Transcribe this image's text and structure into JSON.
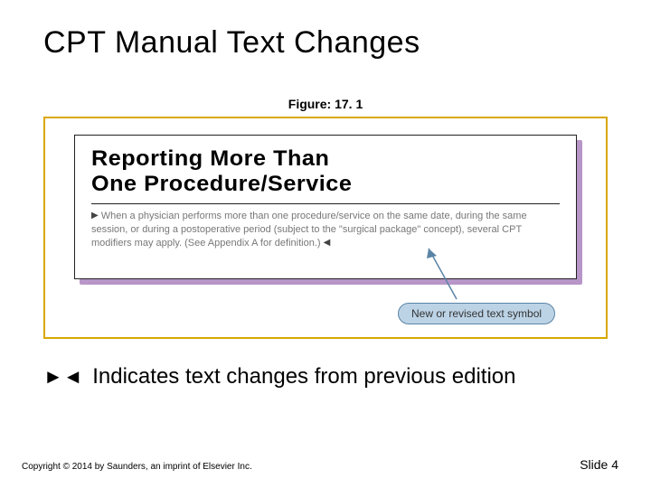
{
  "title": "CPT Manual Text Changes",
  "figure_label": "Figure: 17. 1",
  "callout": {
    "heading_line1": "Reporting More Than",
    "heading_line2": "One Procedure/Service",
    "body": "When a physician performs more than one procedure/service on the same date, during the same session, or during a postoperative period (subject to the \"surgical package\" concept), several CPT modifiers may apply. (See Appendix A for definition.)"
  },
  "pill_label": "New or revised text symbol",
  "note": {
    "symbol": "►◄",
    "text": " Indicates text changes from previous edition"
  },
  "copyright": "Copyright © 2014 by Saunders, an imprint of Elsevier Inc.",
  "slide_number": "Slide 4"
}
